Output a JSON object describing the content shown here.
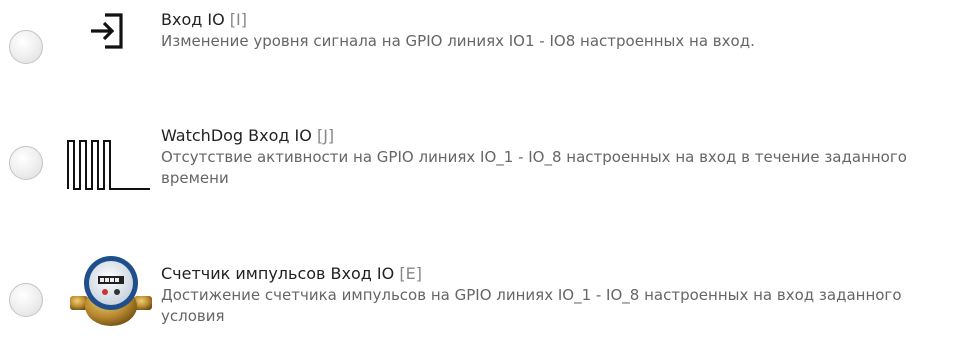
{
  "options": [
    {
      "title": "Вход IO",
      "code": "[I]",
      "description": "Изменение уровня сигнала на GPIO линиях IO1 - IO8 настроенных на вход.",
      "icon": "sign-in-icon",
      "selected": false
    },
    {
      "title": "WatchDog Вход IO",
      "code": "[J]",
      "description": "Отсутствие активности на GPIO линиях IO_1 - IO_8 настроенных на вход в течение заданного времени",
      "icon": "pulse-wave-icon",
      "selected": false
    },
    {
      "title": "Счетчик импульсов Вход IO",
      "code": "[E]",
      "description": "Достижение счетчика импульсов на GPIO линиях IO_1 - IO_8 настроенных на вход заданного условия",
      "icon": "water-meter-icon",
      "selected": false
    }
  ]
}
